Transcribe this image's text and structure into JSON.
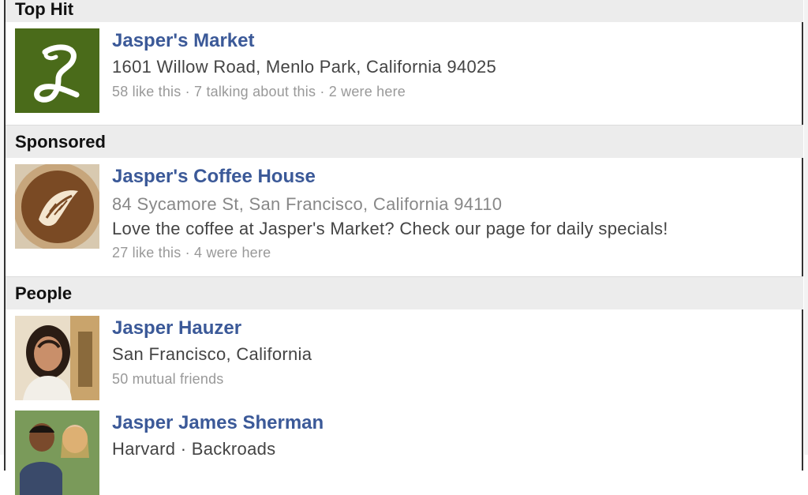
{
  "sections": {
    "top_hit": {
      "header": "Top Hit",
      "item": {
        "name": "Jasper's Market",
        "address": "1601 Willow Road, Menlo Park, California 94025",
        "meta": "58 like this · 7 talking about this · 2 were here",
        "logo_letter": "J",
        "logo_bg": "#4a6b1a"
      }
    },
    "sponsored": {
      "header": "Sponsored",
      "item": {
        "name": "Jasper's Coffee House",
        "address": "84 Sycamore St, San Francisco, California 94110",
        "tagline": "Love the coffee at Jasper's Market? Check our page for daily specials!",
        "meta": "27 like this · 4 were here"
      }
    },
    "people": {
      "header": "People",
      "items": [
        {
          "name": "Jasper Hauzer",
          "location": "San Francisco, California",
          "meta": "50 mutual friends"
        },
        {
          "name": "Jasper James Sherman",
          "location": "Harvard · Backroads"
        }
      ]
    }
  },
  "colors": {
    "link": "#3b5998",
    "header_bg": "#ececec",
    "meta": "#999999"
  }
}
